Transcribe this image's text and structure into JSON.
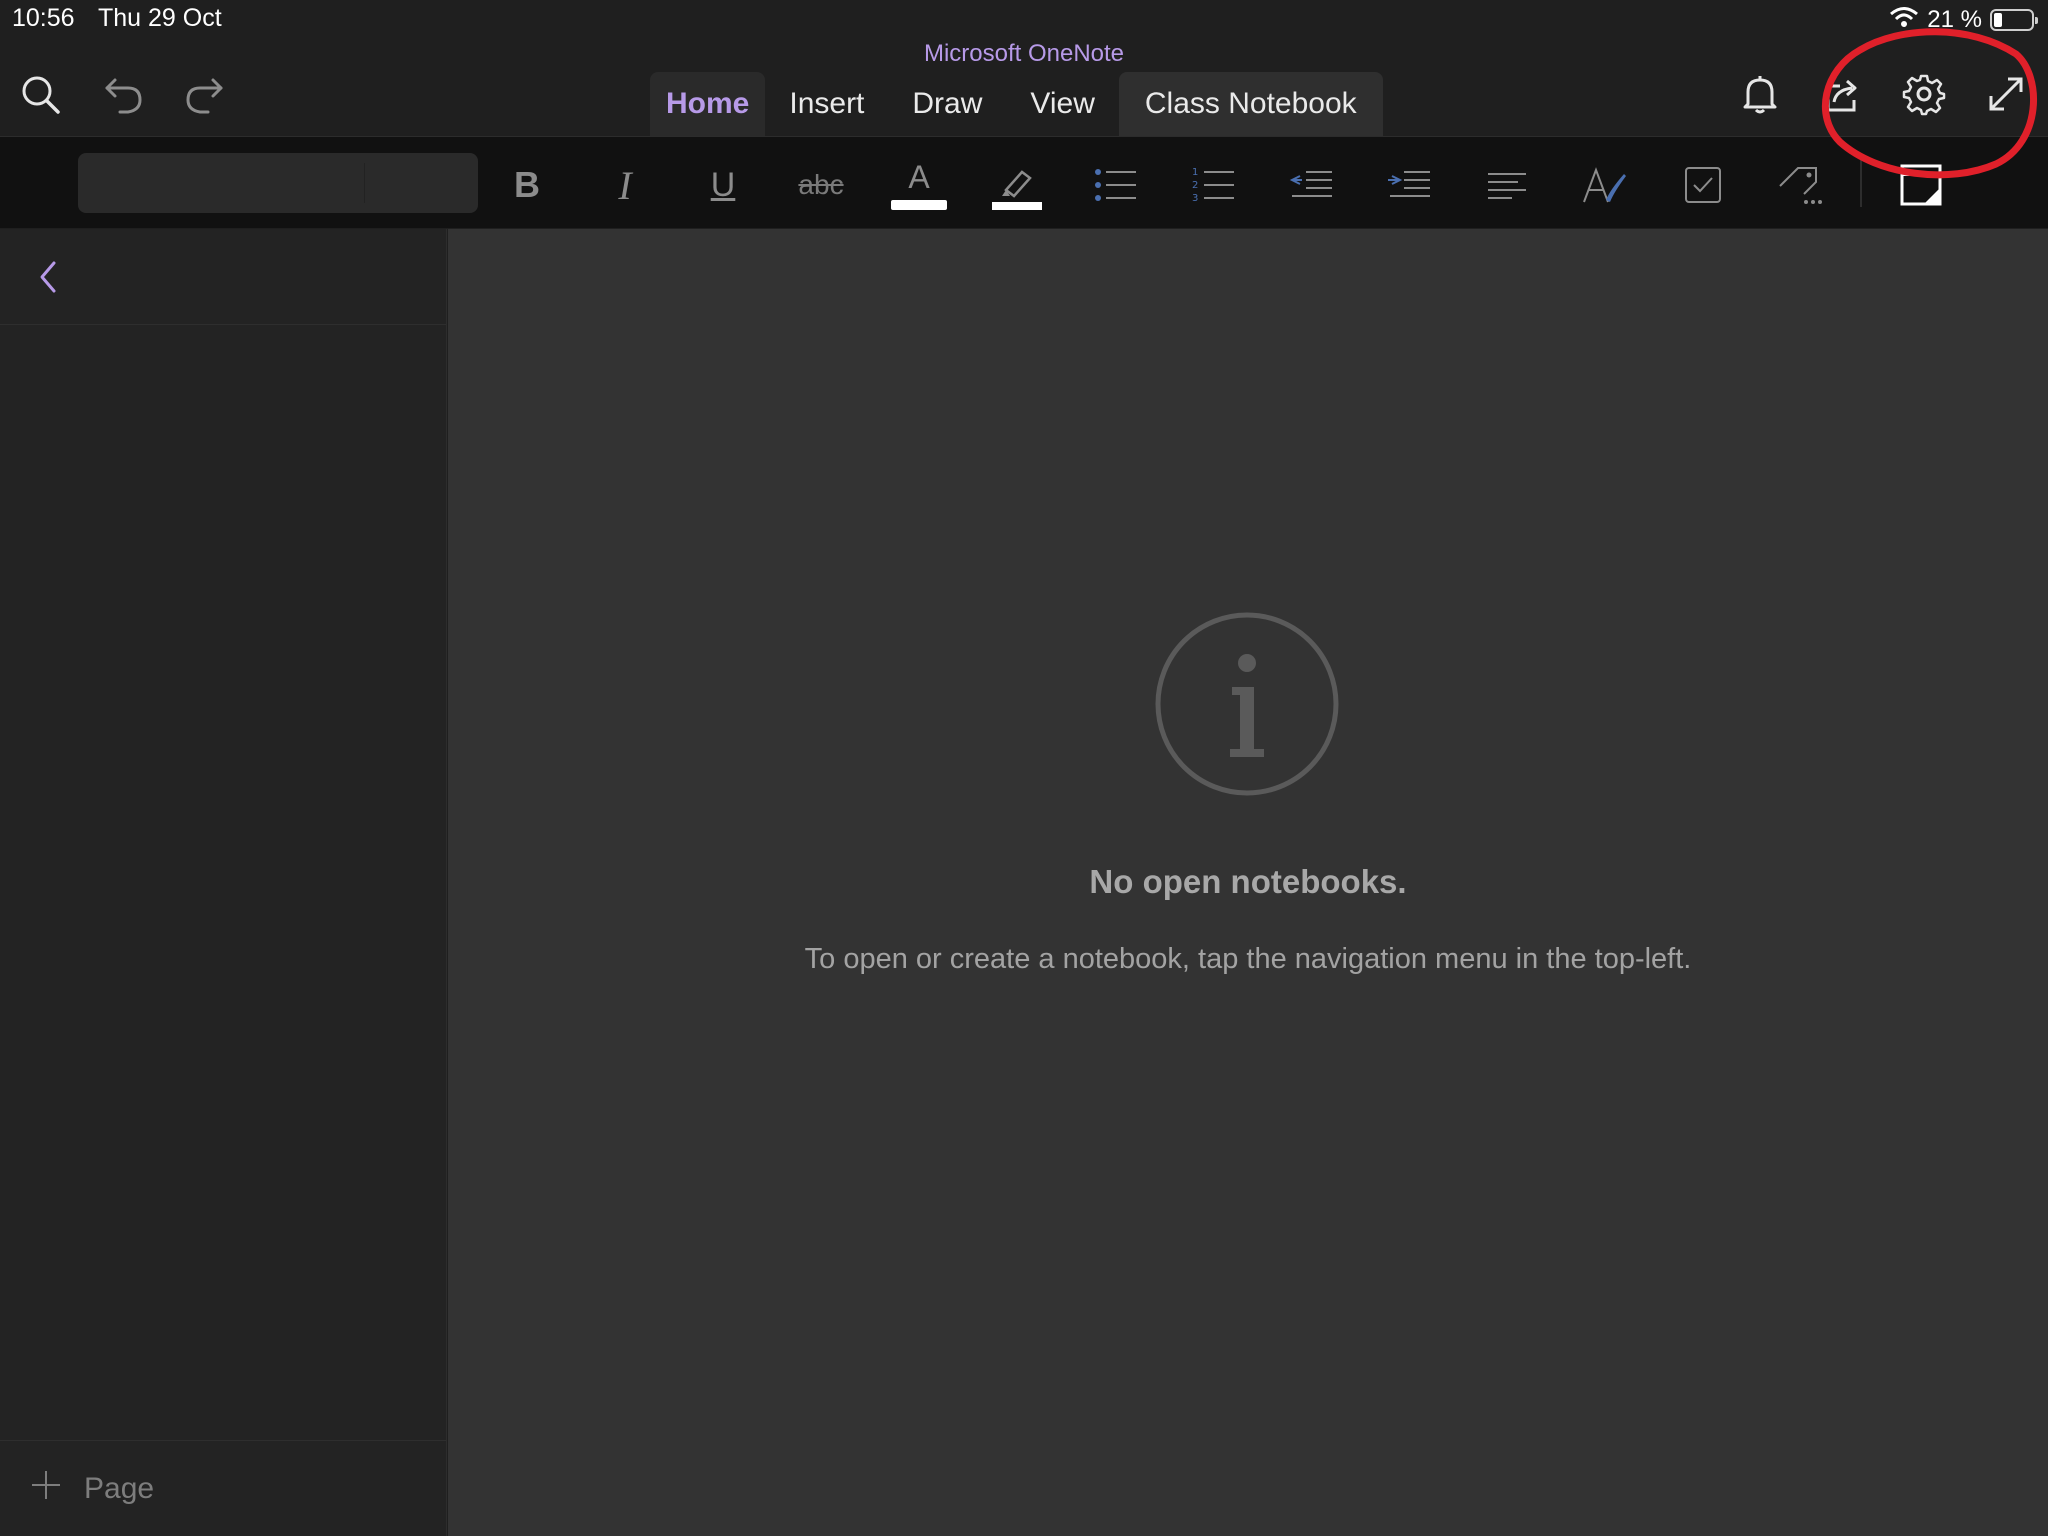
{
  "status_bar": {
    "time": "10:56",
    "date": "Thu 29 Oct",
    "battery": "21 %"
  },
  "app_title": "Microsoft OneNote",
  "toolbar": {
    "icons": [
      "search-icon",
      "undo-icon",
      "redo-icon",
      "bell-icon",
      "share-icon",
      "gear-icon",
      "expand-icon"
    ]
  },
  "tabs": [
    {
      "label": "Home",
      "active": true
    },
    {
      "label": "Insert",
      "active": false
    },
    {
      "label": "Draw",
      "active": false
    },
    {
      "label": "View",
      "active": false
    },
    {
      "label": "Class Notebook",
      "active": false
    }
  ],
  "ribbon": {
    "font_name": "",
    "font_size": "",
    "buttons": [
      "bold",
      "italic",
      "underline",
      "strikethrough",
      "font-color",
      "highlight",
      "bulleted-list",
      "numbered-list",
      "outdent",
      "indent",
      "align",
      "styles",
      "todo-tag",
      "tags",
      "page-color"
    ],
    "bold_label": "B",
    "italic_label": "I",
    "underline_label": "U",
    "strikethrough_label": "abc",
    "font_color_label": "A"
  },
  "sidebar": {
    "add_page_label": "Page"
  },
  "main": {
    "empty_title": "No open notebooks.",
    "empty_text": "To open or create a notebook, tap the navigation menu in the top-left."
  },
  "colors": {
    "accent": "#b79ae8",
    "background": "#1f1f1f",
    "content": "#333333",
    "annotation": "#e0202a"
  }
}
